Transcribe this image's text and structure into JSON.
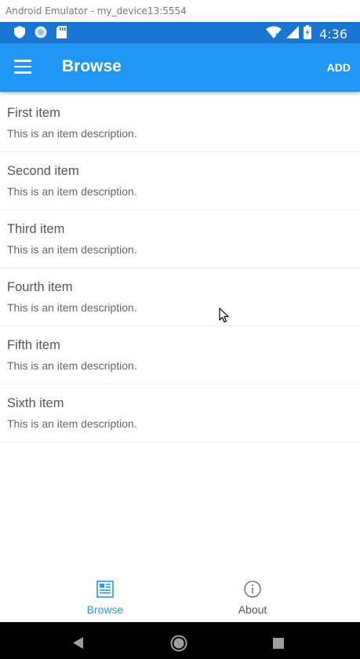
{
  "window": {
    "title": "Android Emulator - my_device13:5554"
  },
  "status_bar": {
    "time": "4:36",
    "bg": "#1976d2"
  },
  "app_bar": {
    "title": "Browse",
    "action_label": "ADD",
    "bg": "#2196f3"
  },
  "items": [
    {
      "title": "First item",
      "description": "This is an item description."
    },
    {
      "title": "Second item",
      "description": "This is an item description."
    },
    {
      "title": "Third item",
      "description": "This is an item description."
    },
    {
      "title": "Fourth item",
      "description": "This is an item description."
    },
    {
      "title": "Fifth item",
      "description": "This is an item description."
    },
    {
      "title": "Sixth item",
      "description": "This is an item description."
    }
  ],
  "bottom_tabs": [
    {
      "label": "Browse",
      "icon": "browse-icon",
      "selected": true,
      "color": "#2196f3"
    },
    {
      "label": "About",
      "icon": "info-icon",
      "selected": false,
      "color": "#757575"
    }
  ],
  "nav_bar": {
    "buttons": [
      "back-icon",
      "home-icon",
      "recents-icon"
    ]
  }
}
